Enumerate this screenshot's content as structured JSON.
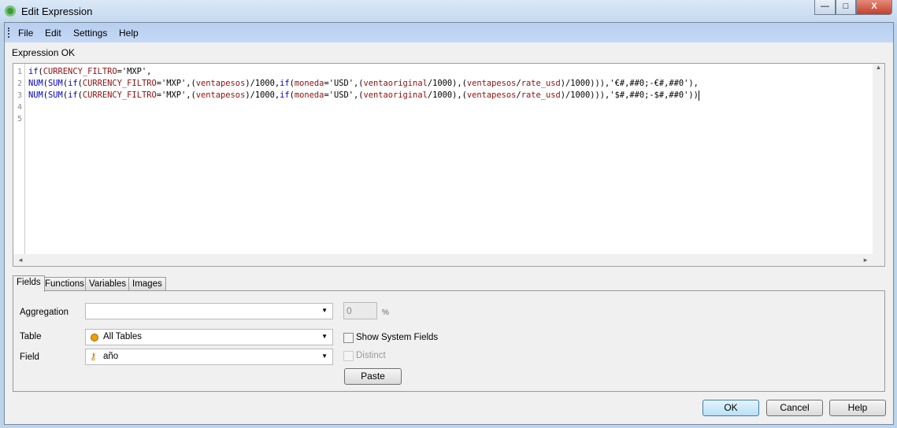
{
  "window": {
    "title": "Edit Expression",
    "minimize": "—",
    "maximize": "□",
    "close": "X"
  },
  "menu": [
    "File",
    "Edit",
    "Settings",
    "Help"
  ],
  "status": "Expression OK",
  "editor": {
    "line_numbers": [
      "1",
      "2",
      "3",
      "4",
      "5"
    ],
    "lines": [
      [
        {
          "t": "if",
          "c": "kw"
        },
        {
          "t": "(",
          "c": "pl"
        },
        {
          "t": "CURRENCY_FILTRO",
          "c": "fld"
        },
        {
          "t": "='MXP',",
          "c": "pl"
        }
      ],
      [
        {
          "t": "NUM",
          "c": "kw"
        },
        {
          "t": "(",
          "c": "pl"
        },
        {
          "t": "SUM",
          "c": "kw"
        },
        {
          "t": "(",
          "c": "pl"
        },
        {
          "t": "if",
          "c": "kw"
        },
        {
          "t": "(",
          "c": "pl"
        },
        {
          "t": "CURRENCY_FILTRO",
          "c": "fld"
        },
        {
          "t": "='MXP',(",
          "c": "pl"
        },
        {
          "t": "ventapesos",
          "c": "fld"
        },
        {
          "t": ")/1000,",
          "c": "pl"
        },
        {
          "t": "if",
          "c": "kw"
        },
        {
          "t": "(",
          "c": "pl"
        },
        {
          "t": "moneda",
          "c": "fld"
        },
        {
          "t": "='USD',(",
          "c": "pl"
        },
        {
          "t": "ventaoriginal",
          "c": "fld"
        },
        {
          "t": "/1000),(",
          "c": "pl"
        },
        {
          "t": "ventapesos",
          "c": "fld"
        },
        {
          "t": "/",
          "c": "pl"
        },
        {
          "t": "rate_usd",
          "c": "fld"
        },
        {
          "t": ")/1000))),'€#,##0;-€#,##0'),",
          "c": "pl"
        }
      ],
      [
        {
          "t": "NUM",
          "c": "kw"
        },
        {
          "t": "(",
          "c": "pl"
        },
        {
          "t": "SUM",
          "c": "kw"
        },
        {
          "t": "(",
          "c": "pl"
        },
        {
          "t": "if",
          "c": "kw"
        },
        {
          "t": "(",
          "c": "pl"
        },
        {
          "t": "CURRENCY_FILTRO",
          "c": "fld"
        },
        {
          "t": "='MXP',(",
          "c": "pl"
        },
        {
          "t": "ventapesos",
          "c": "fld"
        },
        {
          "t": ")/1000,",
          "c": "pl"
        },
        {
          "t": "if",
          "c": "kw"
        },
        {
          "t": "(",
          "c": "pl"
        },
        {
          "t": "moneda",
          "c": "fld"
        },
        {
          "t": "='USD',(",
          "c": "pl"
        },
        {
          "t": "ventaoriginal",
          "c": "fld"
        },
        {
          "t": "/1000),(",
          "c": "pl"
        },
        {
          "t": "ventapesos",
          "c": "fld"
        },
        {
          "t": "/",
          "c": "pl"
        },
        {
          "t": "rate_usd",
          "c": "fld"
        },
        {
          "t": ")/1000))),'$#,##0;-$#,##0'))",
          "c": "pl"
        }
      ],
      [],
      []
    ]
  },
  "tabs": [
    "Fields",
    "Functions",
    "Variables",
    "Images"
  ],
  "fields": {
    "aggregation_label": "Aggregation",
    "aggregation_value": "",
    "percent_value": "0",
    "percent_sign": "%",
    "table_label": "Table",
    "table_value": "All Tables",
    "field_label": "Field",
    "field_value": "año",
    "show_system_fields": "Show System Fields",
    "distinct": "Distinct",
    "paste": "Paste"
  },
  "buttons": {
    "ok": "OK",
    "cancel": "Cancel",
    "help": "Help"
  },
  "colors": {
    "keyword": "#0000c8",
    "field": "#8b1010",
    "menubar": "#b7cff0"
  }
}
